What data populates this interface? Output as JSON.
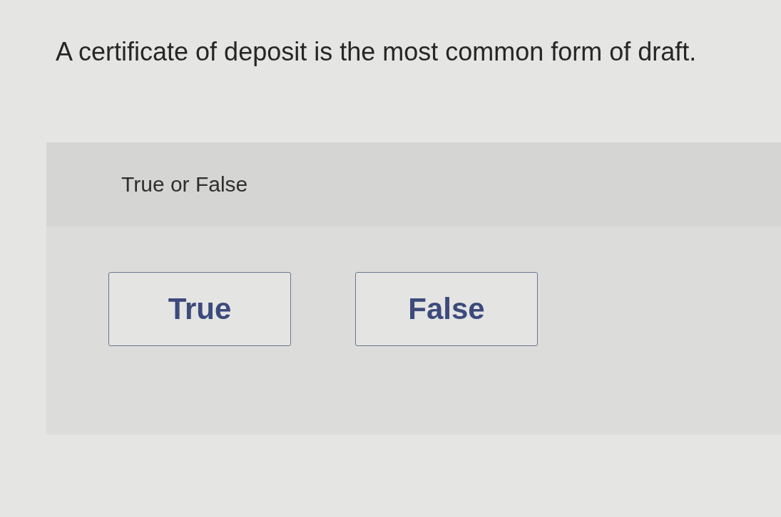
{
  "question": {
    "text": "A certificate of deposit is the most common form of draft."
  },
  "answer_panel": {
    "prompt": "True or False",
    "options": [
      {
        "label": "True",
        "selected": false
      },
      {
        "label": "False",
        "selected": false
      }
    ]
  }
}
